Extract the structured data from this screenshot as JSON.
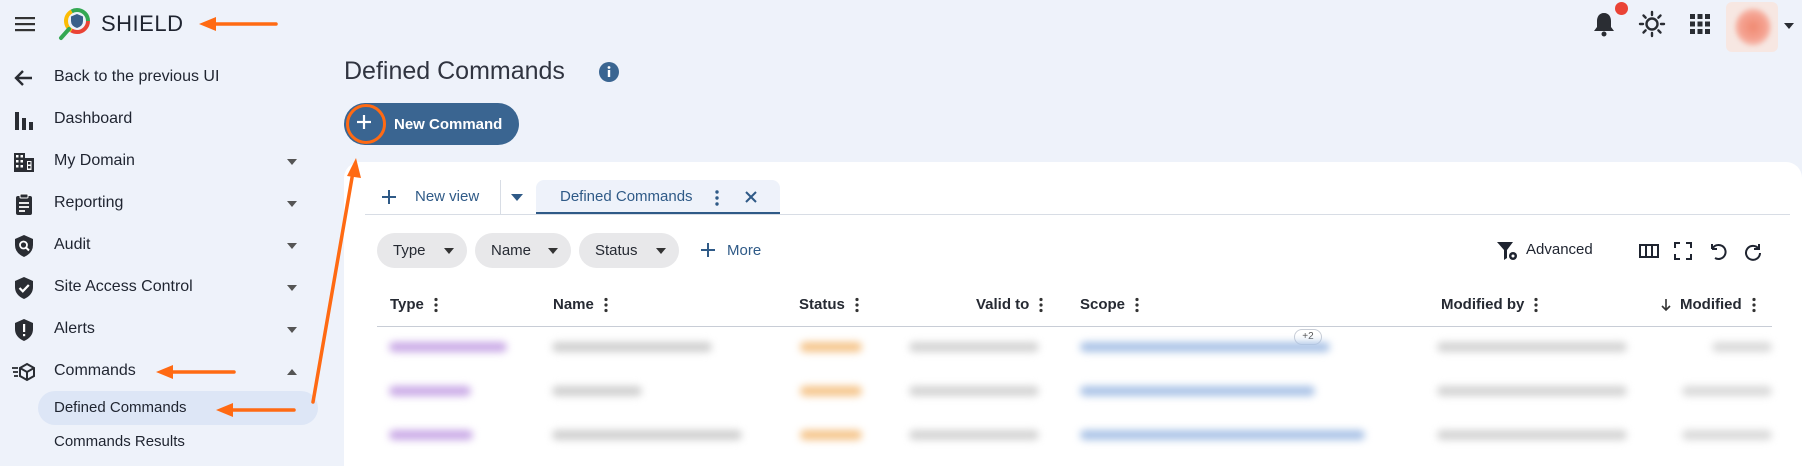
{
  "app": {
    "title": "SHIELD"
  },
  "sidebar": {
    "back_label": "Back to the previous UI",
    "items": [
      {
        "label": "Dashboard",
        "icon": "bar-chart-icon"
      },
      {
        "label": "My Domain",
        "icon": "building-icon"
      },
      {
        "label": "Reporting",
        "icon": "clipboard-icon"
      },
      {
        "label": "Audit",
        "icon": "shield-search-icon"
      },
      {
        "label": "Site Access Control",
        "icon": "shield-check-icon"
      },
      {
        "label": "Alerts",
        "icon": "shield-alert-icon"
      },
      {
        "label": "Commands",
        "icon": "commands-icon"
      }
    ],
    "sub_items": [
      {
        "label": "Defined Commands",
        "active": true
      },
      {
        "label": "Commands Results",
        "active": false
      }
    ]
  },
  "main": {
    "page_title": "Defined Commands",
    "new_command_label": "New Command",
    "tabs": {
      "new_view_label": "New view",
      "active_tab_label": "Defined Commands"
    },
    "filters": {
      "chips": [
        "Type",
        "Name",
        "Status"
      ],
      "more_label": "More",
      "advanced_label": "Advanced"
    },
    "table": {
      "columns": [
        "Type",
        "Name",
        "Status",
        "Valid to",
        "Scope",
        "Modified by",
        "Modified"
      ],
      "scope_overflow_badge": "+2"
    }
  },
  "colors": {
    "accent": "#3a6591",
    "link": "#2f5a87",
    "annotation_arrow": "#ff6a13",
    "notification_dot": "#ea4335",
    "background": "#eef2fa"
  }
}
